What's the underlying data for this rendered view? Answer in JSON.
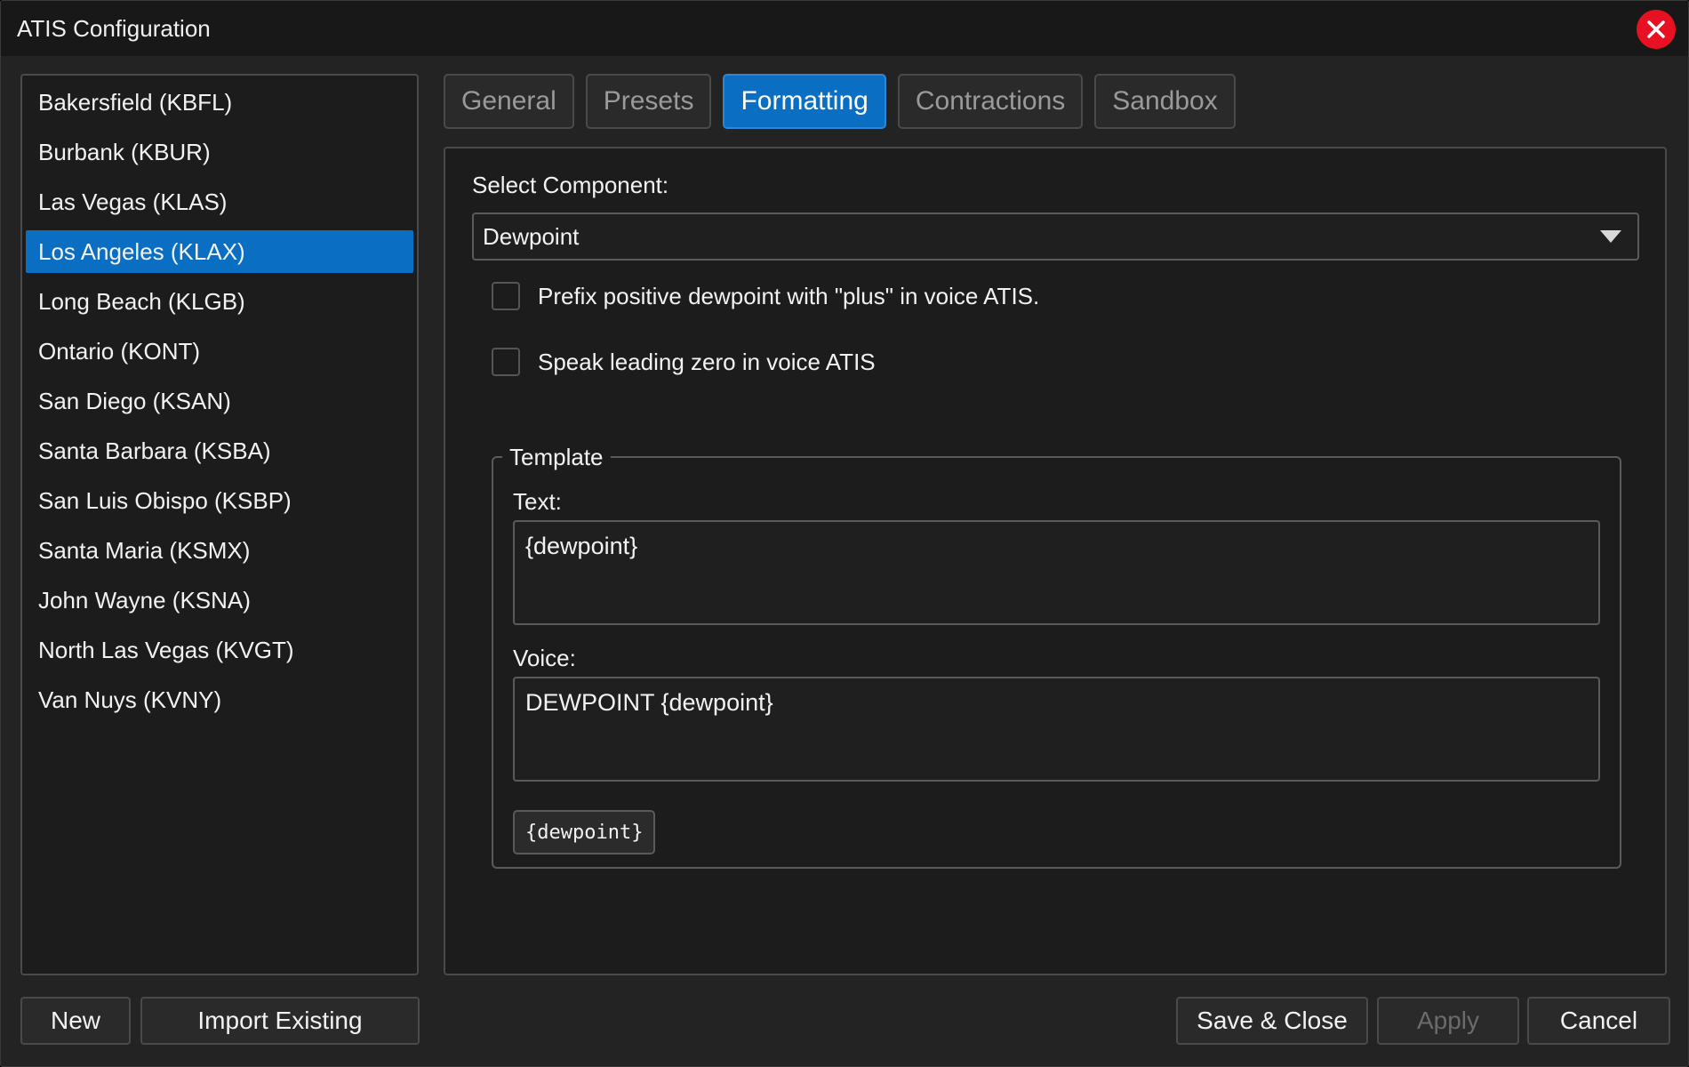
{
  "window": {
    "title": "ATIS Configuration"
  },
  "airports": [
    {
      "label": "Bakersfield (KBFL)",
      "selected": false
    },
    {
      "label": "Burbank (KBUR)",
      "selected": false
    },
    {
      "label": "Las Vegas (KLAS)",
      "selected": false
    },
    {
      "label": "Los Angeles (KLAX)",
      "selected": true
    },
    {
      "label": "Long Beach (KLGB)",
      "selected": false
    },
    {
      "label": "Ontario (KONT)",
      "selected": false
    },
    {
      "label": "San Diego (KSAN)",
      "selected": false
    },
    {
      "label": "Santa Barbara (KSBA)",
      "selected": false
    },
    {
      "label": "San Luis Obispo (KSBP)",
      "selected": false
    },
    {
      "label": "Santa Maria (KSMX)",
      "selected": false
    },
    {
      "label": "John Wayne (KSNA)",
      "selected": false
    },
    {
      "label": "North Las Vegas (KVGT)",
      "selected": false
    },
    {
      "label": "Van Nuys (KVNY)",
      "selected": false
    }
  ],
  "tabs": [
    {
      "label": "General",
      "active": false
    },
    {
      "label": "Presets",
      "active": false
    },
    {
      "label": "Formatting",
      "active": true
    },
    {
      "label": "Contractions",
      "active": false
    },
    {
      "label": "Sandbox",
      "active": false
    }
  ],
  "formatting": {
    "select_label": "Select Component:",
    "select_value": "Dewpoint",
    "checkboxes": [
      {
        "label": "Prefix positive dewpoint with \"plus\" in voice ATIS.",
        "checked": false
      },
      {
        "label": "Speak leading zero in voice ATIS",
        "checked": false
      }
    ],
    "template": {
      "legend": "Template",
      "text_label": "Text:",
      "text_value": "{dewpoint}",
      "voice_label": "Voice:",
      "voice_value": "DEWPOINT {dewpoint}",
      "token_label": "{dewpoint}"
    }
  },
  "footer": {
    "new_label": "New",
    "import_label": "Import Existing",
    "save_close_label": "Save & Close",
    "apply_label": "Apply",
    "cancel_label": "Cancel"
  },
  "colors": {
    "accent": "#0a6ec2",
    "close": "#e81123"
  },
  "icons": {
    "close": "close-icon",
    "dropdown": "chevron-down-icon"
  }
}
